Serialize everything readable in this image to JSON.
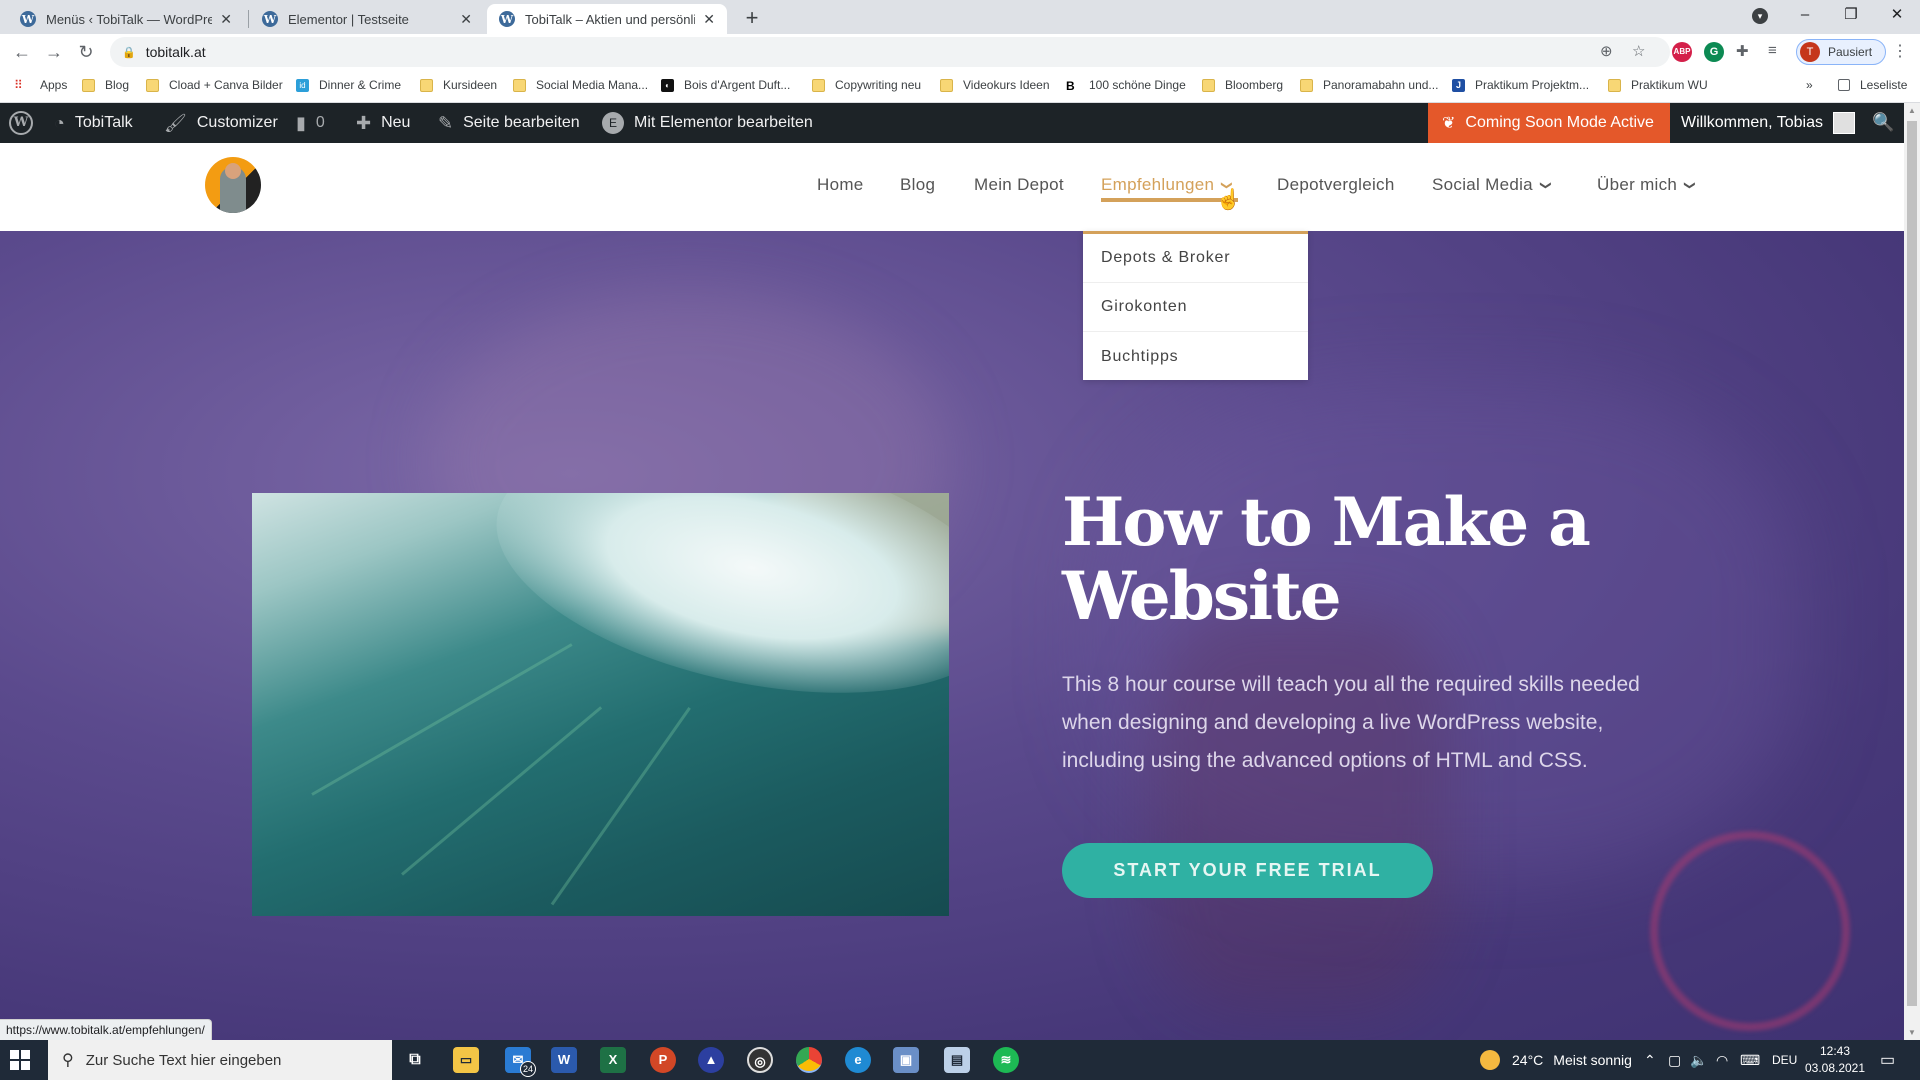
{
  "browser": {
    "tabs": [
      {
        "title": "Menüs ‹ TobiTalk — WordPress",
        "active": false
      },
      {
        "title": "Elementor | Testseite",
        "active": false
      },
      {
        "title": "TobiTalk – Aktien und persönliche",
        "active": true
      }
    ],
    "new_tab": "+",
    "window_controls": {
      "minimize": "–",
      "restore": "❐",
      "close": "✕"
    },
    "url": "tobitalk.at",
    "profile_initial": "T",
    "profile_status": "Pausiert",
    "extensions": [
      "ABP",
      "Grammarly",
      "Extensions",
      "Media"
    ],
    "bookmarks": [
      {
        "label": "Apps",
        "icon": "apps-grid"
      },
      {
        "label": "Blog",
        "icon": "folder"
      },
      {
        "label": "Cload + Canva Bilder",
        "icon": "folder"
      },
      {
        "label": "Dinner & Crime",
        "icon": "id-logo"
      },
      {
        "label": "Kursideen",
        "icon": "folder"
      },
      {
        "label": "Social Media Mana...",
        "icon": "folder"
      },
      {
        "label": "Bois d'Argent Duft...",
        "icon": "bois-logo"
      },
      {
        "label": "Copywriting neu",
        "icon": "folder"
      },
      {
        "label": "Videokurs Ideen",
        "icon": "folder"
      },
      {
        "label": "100 schöne Dinge",
        "icon": "b-logo"
      },
      {
        "label": "Bloomberg",
        "icon": "folder"
      },
      {
        "label": "Panoramabahn und...",
        "icon": "folder"
      },
      {
        "label": "Praktikum Projektm...",
        "icon": "j-logo"
      },
      {
        "label": "Praktikum WU",
        "icon": "folder"
      }
    ],
    "bookmarks_overflow": "»",
    "reading_list": "Leseliste",
    "status_url": "https://www.tobitalk.at/empfehlungen/"
  },
  "admin_bar": {
    "site_name": "TobiTalk",
    "customizer": "Customizer",
    "comments_count": "0",
    "new": "Neu",
    "edit_page": "Seite bearbeiten",
    "edit_elementor": "Mit Elementor bearbeiten",
    "coming_soon": "Coming Soon Mode Active",
    "welcome": "Willkommen, Tobias",
    "coming_soon_color": "#e4582a"
  },
  "site": {
    "nav": [
      {
        "label": "Home",
        "has_dropdown": false,
        "active": false
      },
      {
        "label": "Blog",
        "has_dropdown": false,
        "active": false
      },
      {
        "label": "Mein Depot",
        "has_dropdown": false,
        "active": false
      },
      {
        "label": "Empfehlungen",
        "has_dropdown": true,
        "active": true
      },
      {
        "label": "Depotvergleich",
        "has_dropdown": false,
        "active": false
      },
      {
        "label": "Social Media",
        "has_dropdown": true,
        "active": false
      },
      {
        "label": "Über mich",
        "has_dropdown": true,
        "active": false
      }
    ],
    "dropdown": [
      "Depots & Broker",
      "Girokonten",
      "Buchtipps"
    ],
    "accent_color": "#d4a15a",
    "hero": {
      "title": "How to Make a Website",
      "text": "This 8 hour course will teach you all the required skills needed when designing and developing a live WordPress website, including using the advanced options of HTML and CSS.",
      "cta": "START YOUR FREE TRIAL",
      "cta_color": "#2fb1a3"
    }
  },
  "taskbar": {
    "search_placeholder": "Zur Suche Text hier eingeben",
    "mail_badge": "24",
    "apps": [
      "Task View",
      "File Explorer",
      "Mail",
      "Word",
      "Excel",
      "PowerPoint",
      "App",
      "OBS",
      "Chrome",
      "Edge",
      "App",
      "Notepad",
      "Spotify"
    ],
    "weather_temp": "24°C",
    "weather_text": "Meist sonnig",
    "language": "DEU",
    "time": "12:43",
    "date": "03.08.2021"
  }
}
